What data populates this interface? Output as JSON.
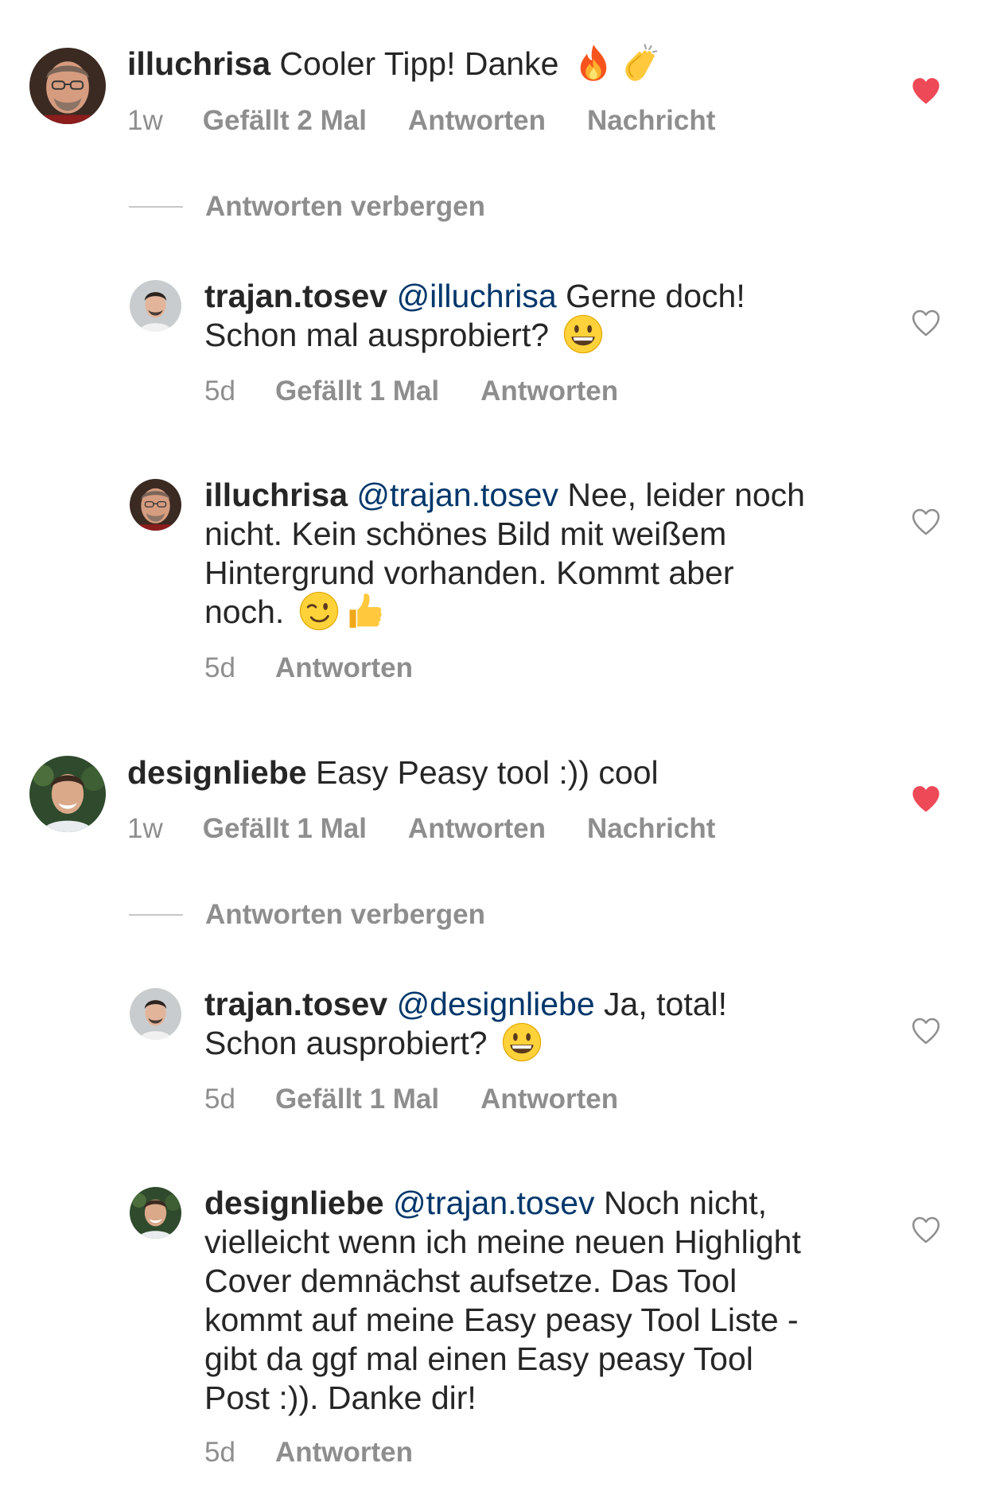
{
  "colors": {
    "text": "#262626",
    "secondary": "#8e8e8e",
    "mention": "#00376b",
    "liked_heart": "#ed4956"
  },
  "thread_1": {
    "comment": {
      "username": "illuchrisa",
      "text": "Cooler Tipp! Danke",
      "emojis": [
        "fire",
        "clapping-hands"
      ],
      "time": "1w",
      "likes_label": "Gefällt 2 Mal",
      "reply_label": "Antworten",
      "message_label": "Nachricht",
      "liked": true
    },
    "hide_replies_label": "Antworten verbergen",
    "replies": [
      {
        "username": "trajan.tosev",
        "mention": "@illuchrisa",
        "text_line1": "Gerne doch!",
        "text_line2": "Schon mal ausprobiert?",
        "emojis": [
          "grinning-face"
        ],
        "time": "5d",
        "likes_label": "Gefällt 1 Mal",
        "reply_label": "Antworten",
        "liked": false
      },
      {
        "username": "illuchrisa",
        "mention": "@trajan.tosev",
        "text_line1": "Nee, leider noch",
        "text_line2": "nicht. Kein schönes Bild mit weißem",
        "text_line3": "Hintergrund vorhanden. Kommt aber",
        "text_line4": "noch.",
        "emojis": [
          "winking-face",
          "thumbs-up"
        ],
        "time": "5d",
        "reply_label": "Antworten",
        "liked": false
      }
    ]
  },
  "thread_2": {
    "comment": {
      "username": "designliebe",
      "text": "Easy Peasy tool :)) cool",
      "time": "1w",
      "likes_label": "Gefällt 1 Mal",
      "reply_label": "Antworten",
      "message_label": "Nachricht",
      "liked": true
    },
    "hide_replies_label": "Antworten verbergen",
    "replies": [
      {
        "username": "trajan.tosev",
        "mention": "@designliebe",
        "text_line1": "Ja, total!",
        "text_line2": "Schon ausprobiert?",
        "emojis": [
          "grinning-face"
        ],
        "time": "5d",
        "likes_label": "Gefällt 1 Mal",
        "reply_label": "Antworten",
        "liked": false
      },
      {
        "username": "designliebe",
        "mention": "@trajan.tosev",
        "text_line1": "Noch nicht,",
        "text_line2": "vielleicht wenn ich meine neuen Highlight",
        "text_line3": "Cover demnächst aufsetze. Das Tool",
        "text_line4": "kommt auf meine Easy peasy Tool Liste -",
        "text_line5": "gibt da ggf mal einen Easy peasy Tool",
        "text_line6": "Post :)). Danke dir!",
        "time": "5d",
        "reply_label": "Antworten",
        "liked": false
      }
    ]
  }
}
